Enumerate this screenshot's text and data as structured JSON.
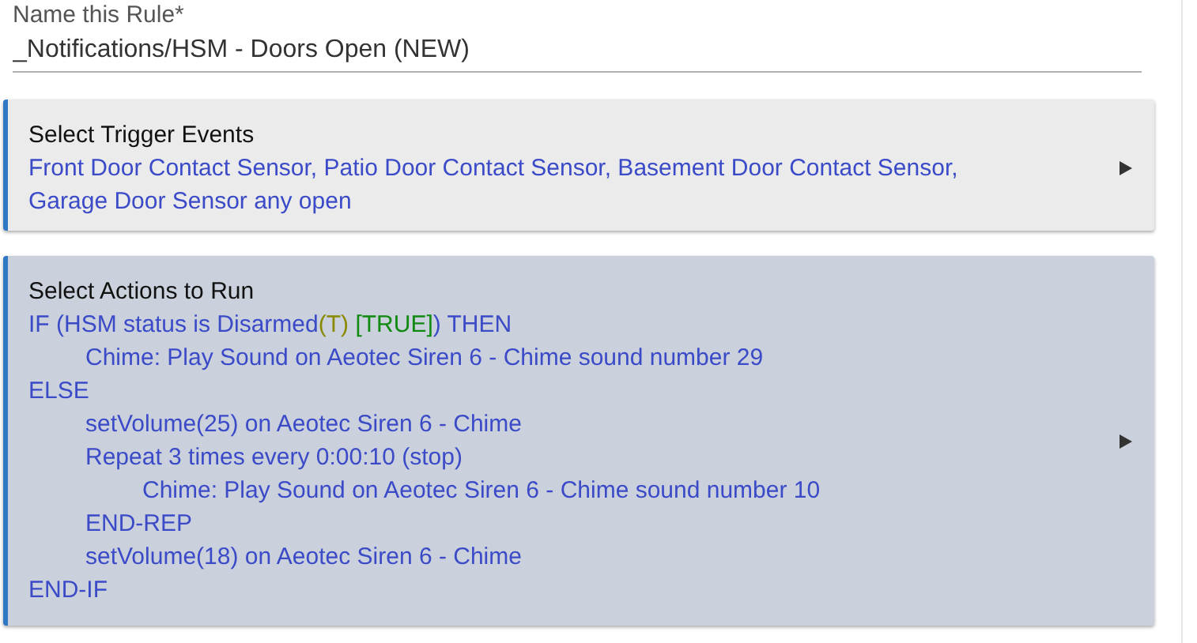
{
  "name_field": {
    "label": "Name this Rule*",
    "value": "_Notifications/HSM - Doors Open (NEW)"
  },
  "sections": [
    {
      "kind": "trigger",
      "title": "Select Trigger Events",
      "lines": [
        {
          "text": "Front Door Contact Sensor, Patio Door Contact Sensor, Basement Door Contact Sensor,"
        },
        {
          "text": "Garage Door Sensor any open"
        }
      ]
    },
    {
      "kind": "actions",
      "title": "Select Actions to Run",
      "lines": [
        {
          "segments": [
            {
              "text": "IF (HSM status is Disarmed",
              "color": "#3b4bc8"
            },
            {
              "text": "(T)",
              "color": "#8a8a00"
            },
            {
              "text": " [TRUE]",
              "color": "#108a10"
            },
            {
              "text": ") THEN",
              "color": "#3b4bc8"
            }
          ],
          "children": [
            {
              "text": "Chime: Play Sound on Aeotec Siren 6 - Chime sound number 29"
            }
          ]
        },
        {
          "text": "ELSE",
          "children": [
            {
              "text": "setVolume(25) on Aeotec Siren 6 - Chime"
            },
            {
              "text": "Repeat 3 times every 0:00:10 (stop)",
              "children": [
                {
                  "text": "Chime: Play Sound on Aeotec Siren 6 - Chime sound number 10"
                }
              ]
            },
            {
              "text": "END-REP"
            },
            {
              "text": "setVolume(18) on Aeotec Siren 6 - Chime"
            }
          ]
        },
        {
          "text": "END-IF"
        }
      ]
    }
  ]
}
